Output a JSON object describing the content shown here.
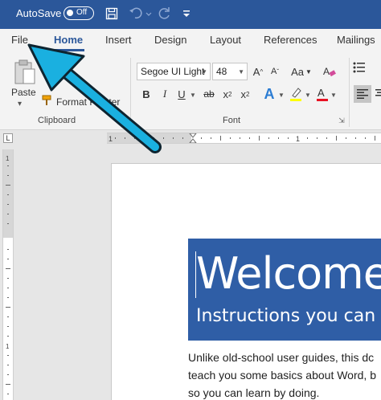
{
  "titlebar": {
    "autosave_label": "AutoSave",
    "autosave_state": "Off",
    "icons": [
      "save-icon",
      "undo-icon",
      "redo-icon",
      "customize-icon"
    ]
  },
  "tabs": [
    {
      "label": "File"
    },
    {
      "label": "Home",
      "active": true
    },
    {
      "label": "Insert"
    },
    {
      "label": "Design"
    },
    {
      "label": "Layout"
    },
    {
      "label": "References"
    },
    {
      "label": "Mailings"
    }
  ],
  "clipboard": {
    "paste_label": "Paste",
    "format_painter_label": "Format Painter",
    "group_label": "Clipboard"
  },
  "font": {
    "name": "Segoe UI Light",
    "size": "48",
    "group_label": "Font",
    "grow_label": "A",
    "shrink_label": "A",
    "change_case_label": "Aa",
    "bold": "B",
    "italic": "I",
    "underline": "U",
    "strikethrough": "ab",
    "subscript": "x",
    "superscript": "x",
    "text_effects": "A",
    "highlight_color": "#ffff00",
    "font_color": "#e81123"
  },
  "document": {
    "title": "Welcome",
    "subtitle": "Instructions you can e",
    "body_lines": [
      "Unlike old-school user guides, this dc",
      "teach you some basics about Word, b",
      "so you can learn by doing."
    ]
  },
  "colors": {
    "accent": "#2b579a",
    "banner": "#2f5ea6",
    "arrow": "#1ab0e0"
  }
}
